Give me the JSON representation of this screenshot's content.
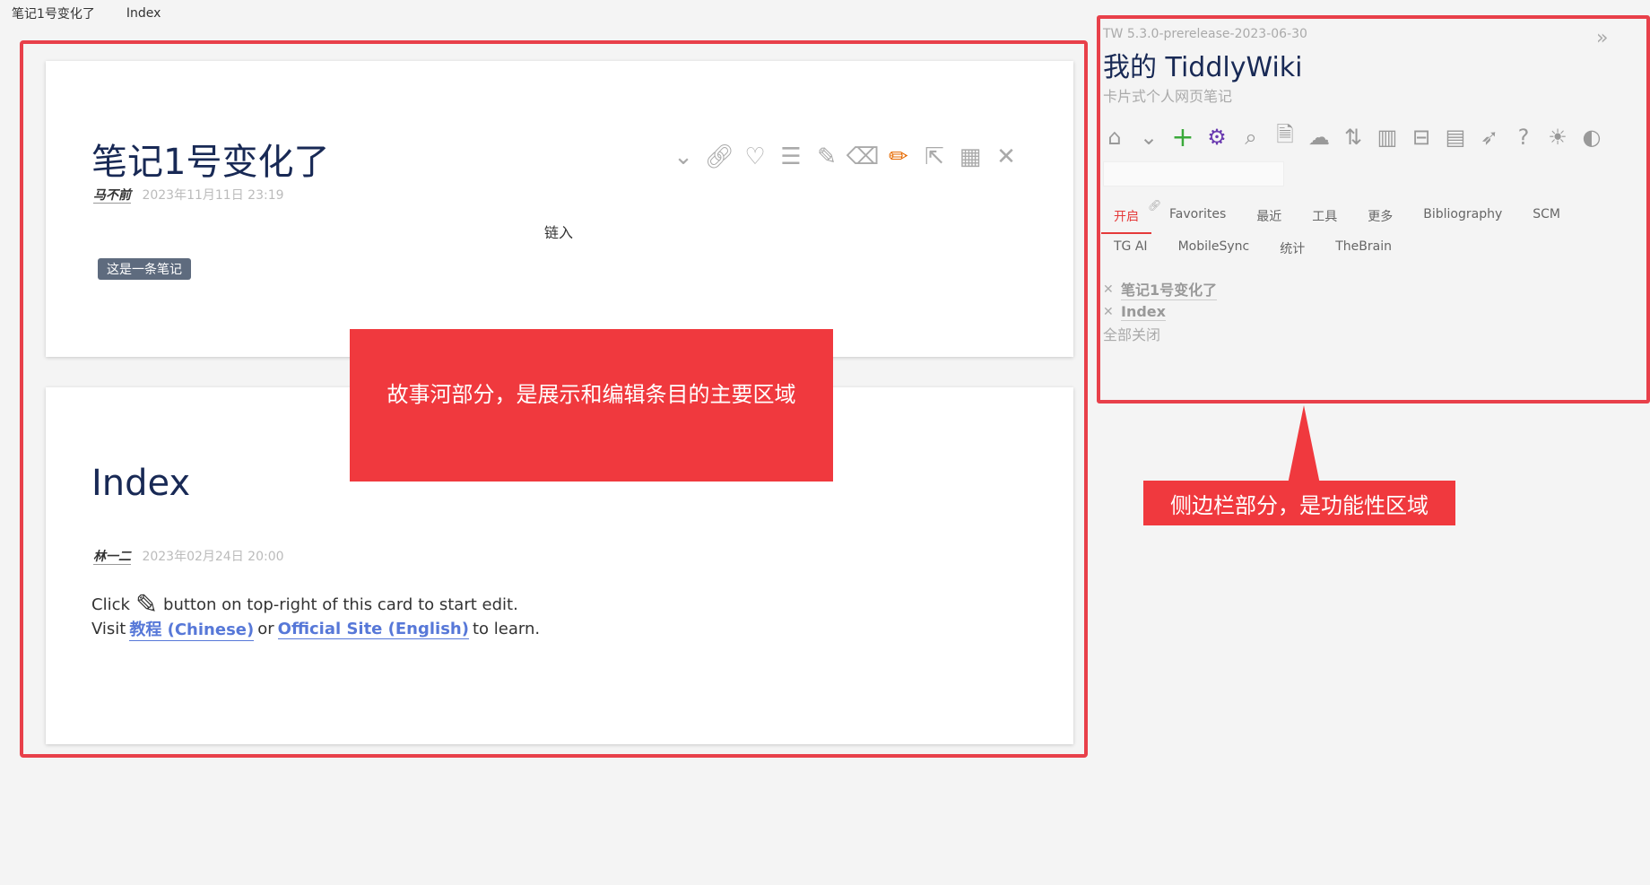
{
  "topbar": {
    "tab1": "笔记1号变化了",
    "tab2": "Index"
  },
  "story": {
    "tiddler1": {
      "title": "笔记1号变化了",
      "author": "马不前",
      "date": "2023年11月11日 23:19",
      "transclude": "链入",
      "tag": "这是一条笔记"
    },
    "tiddler2": {
      "title": "Index",
      "author": "林一二",
      "date": "2023年02月24日 20:00",
      "line1_pre": "Click",
      "line1_post": "button on top-right of this card to start edit.",
      "line2_pre": "Visit",
      "link1": "教程 (Chinese)",
      "line2_mid": "or",
      "link2": "Official Site (English)",
      "line2_post": "to learn."
    }
  },
  "callouts": {
    "story": "故事河部分，是展示和编辑条目的主要区域",
    "sidebar": "侧边栏部分，是功能性区域"
  },
  "sidebar": {
    "version": "TW 5.3.0-prerelease-2023-06-30",
    "title": "我的 TiddlyWiki",
    "subtitle": "卡片式个人网页笔记",
    "tabs": [
      "开启",
      "Favorites",
      "最近",
      "工具",
      "更多",
      "Bibliography",
      "SCM",
      "TG AI",
      "MobileSync",
      "统计",
      "TheBrain"
    ],
    "open": [
      "笔记1号变化了",
      "Index"
    ],
    "close_all": "全部关闭"
  }
}
